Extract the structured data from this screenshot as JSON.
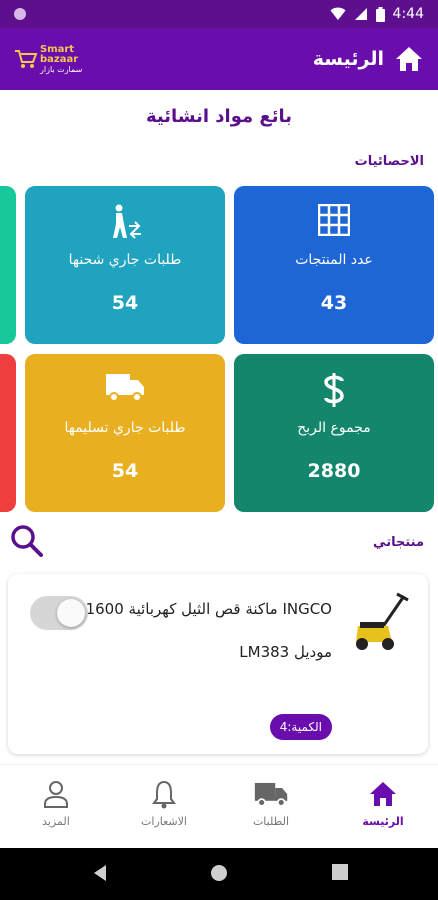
{
  "status_bar": {
    "time": "4:44"
  },
  "app_bar": {
    "title": "الرئيسة",
    "logo_line1": "Smart",
    "logo_line2": "bazaar",
    "logo_ar": "سمارت بازار"
  },
  "page_title": "بائع مواد انشائية",
  "stats_label": "الاحصائيات",
  "stats": {
    "products_count": {
      "label": "عدد المنتجات",
      "value": "43",
      "color": "#1e65d6"
    },
    "shipping_orders": {
      "label": "طلبات جاري شحنها",
      "value": "54",
      "color": "#1fa3bf"
    },
    "profit_total": {
      "label": "مجموع الربح",
      "value": "2880",
      "color": "#14866b"
    },
    "delivering_orders": {
      "label": "طلبات جاري تسليمها",
      "value": "54",
      "color": "#e8b020"
    }
  },
  "products_label": "منتجاتي",
  "product": {
    "name": "INGCO ماكنة قص الثيل كهربائية 1600 واط موديل LM383",
    "quantity": "الكمية:4",
    "active": false
  },
  "bottom_nav": {
    "home": "الرئيسة",
    "orders": "الطلبات",
    "notifications": "الاشعارات",
    "more": "المزيد"
  },
  "colors": {
    "primary": "#6a0dad",
    "status_bar": "#5e0f8d"
  }
}
